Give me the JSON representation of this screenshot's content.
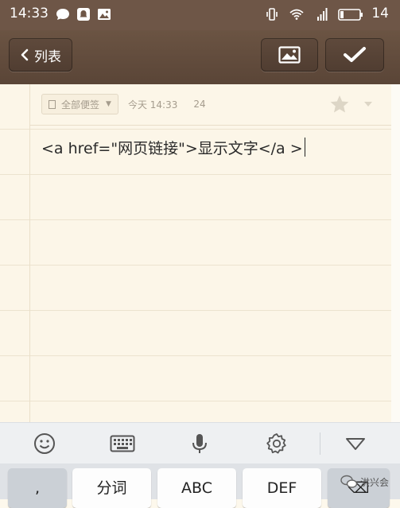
{
  "status_bar": {
    "time": "14:33",
    "battery_percent": "14",
    "left_icons": [
      "message-icon",
      "notification-icon",
      "image-icon"
    ],
    "right_icons": [
      "vibrate-icon",
      "wifi-icon",
      "4g-signal-icon",
      "battery-icon"
    ]
  },
  "toolbar": {
    "back_label": "列表",
    "back_icon": "chevron-left-icon",
    "insert_image_icon": "image-icon",
    "done_icon": "check-icon"
  },
  "note": {
    "folder": "全部便签",
    "timestamp": "今天 14:33",
    "char_count": "24",
    "content": "<a href=\"网页链接\">显示文字</a >",
    "starred": false
  },
  "keyboard": {
    "toolbar_icons": [
      "emoji-icon",
      "keyboard-icon",
      "microphone-icon",
      "settings-icon",
      "collapse-icon"
    ],
    "keys": [
      {
        "label": ","
      },
      {
        "label": "分词"
      },
      {
        "label": "ABC"
      },
      {
        "label": "DEF"
      },
      {
        "label": "⌫"
      }
    ]
  },
  "watermark": {
    "text": "洪兴会",
    "icon": "wechat-icon"
  },
  "colors": {
    "toolbar": "#5a4537",
    "note_background": "#fcf6e8",
    "keyboard_background": "#eef0f2"
  }
}
